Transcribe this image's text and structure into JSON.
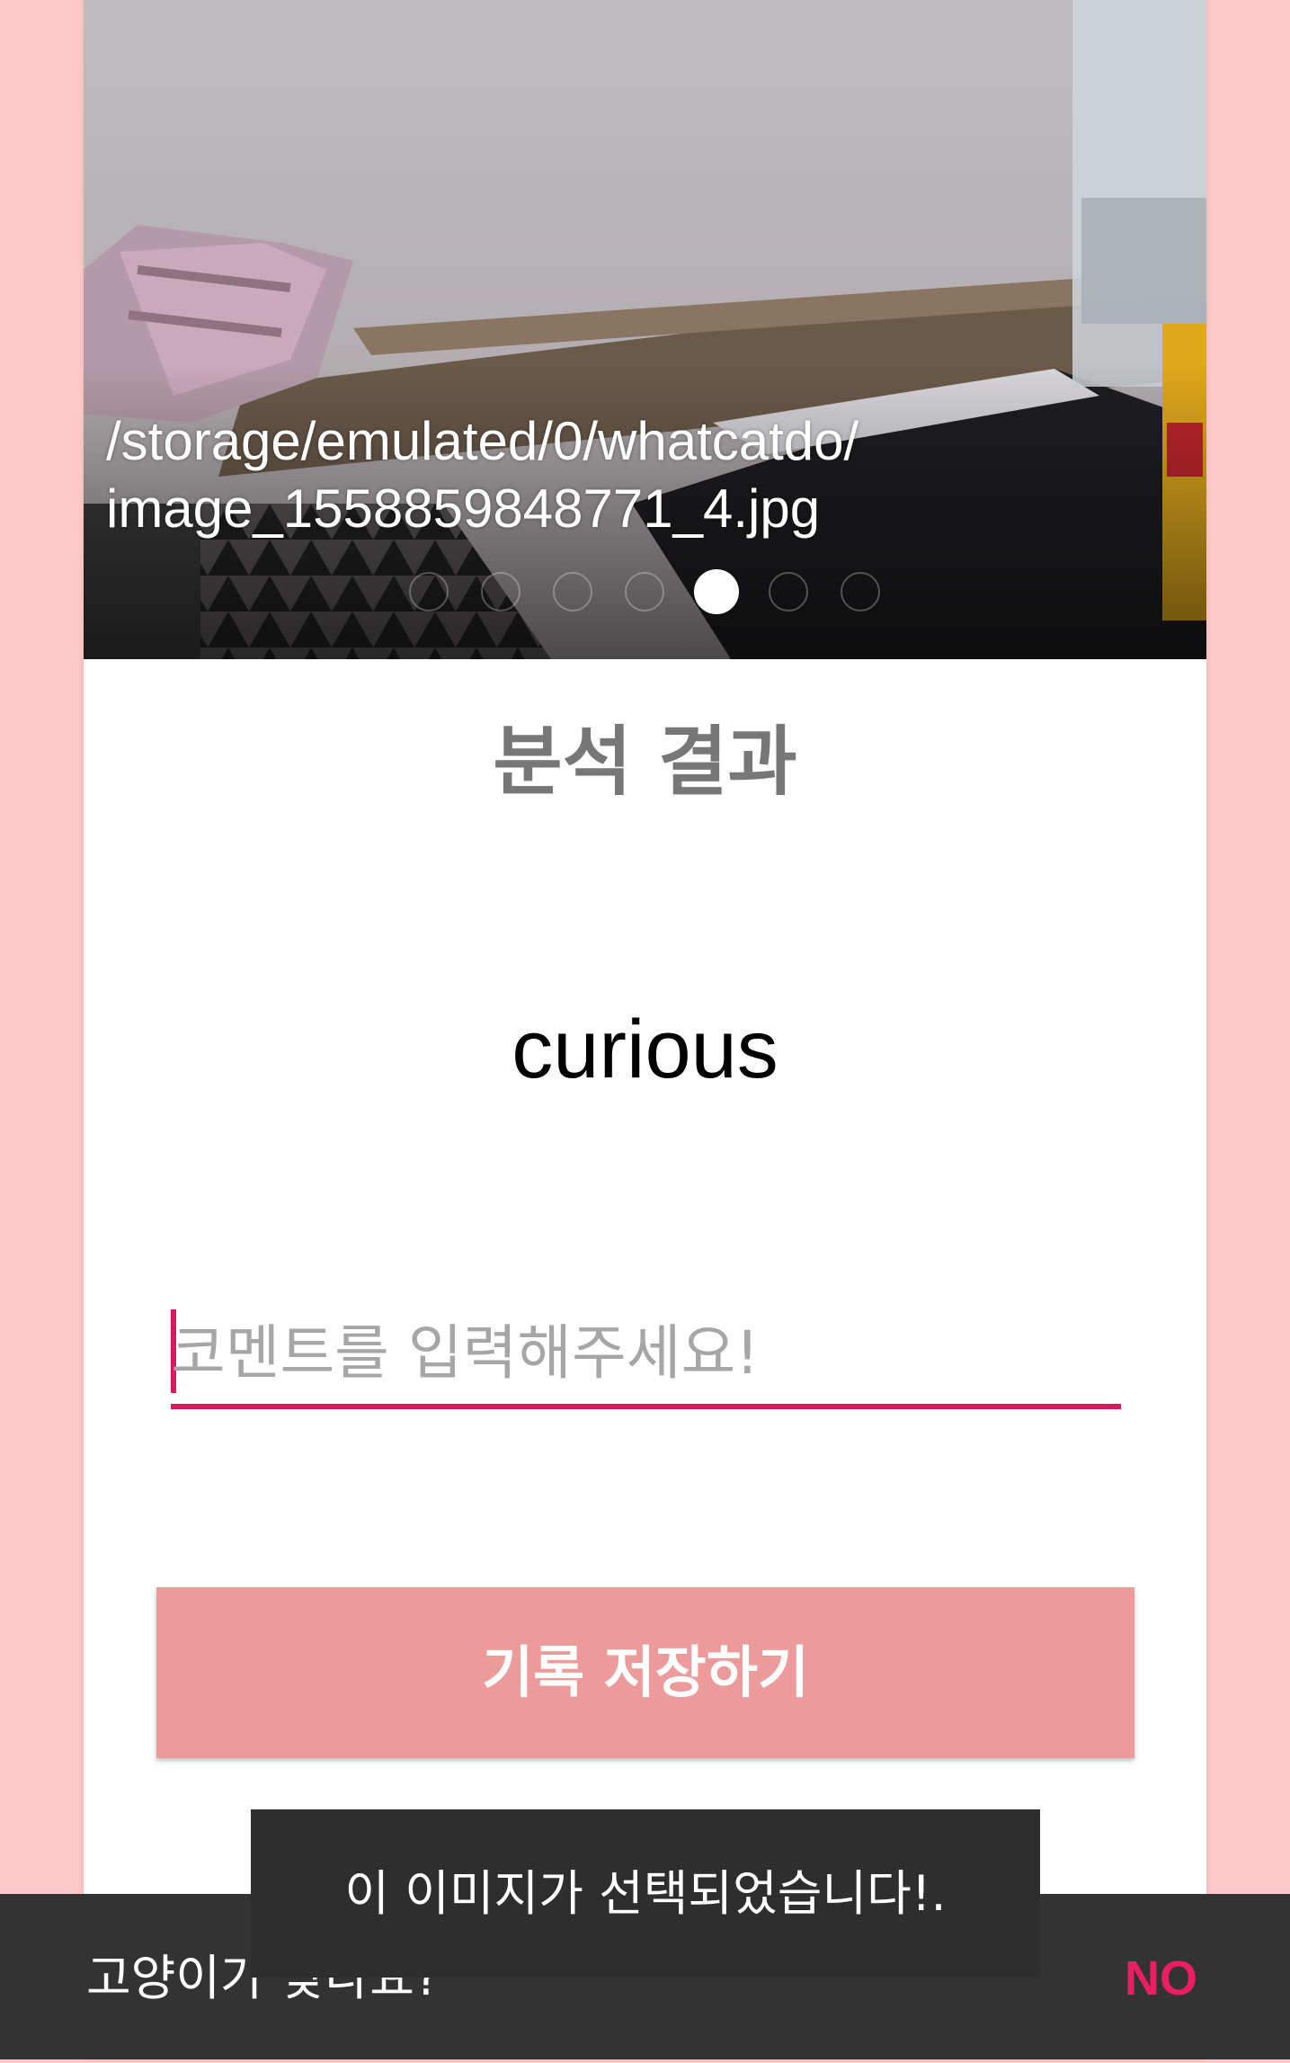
{
  "image_pager": {
    "path_caption_line1": "/storage/emulated/0/whatcatdo/",
    "path_caption_line2": "image_1558859848771_4.jpg",
    "page_count": 7,
    "active_page": 5
  },
  "result": {
    "title": "분석 결과",
    "value": "curious"
  },
  "comment": {
    "placeholder": "코멘트를 입력해주세요!",
    "value": ""
  },
  "save_button": {
    "label": "기록 저장하기"
  },
  "toast": {
    "message": "이 이미지가 선택되었습니다!."
  },
  "snackbar": {
    "message": "고양이가 맞나요?",
    "action_label": "NO"
  },
  "colors": {
    "page_background": "#FFC9C9",
    "accent": "#D81B60",
    "button_background": "#EC9A9A",
    "snackbar_background": "#333333",
    "snackbar_action": "#E91E63"
  }
}
